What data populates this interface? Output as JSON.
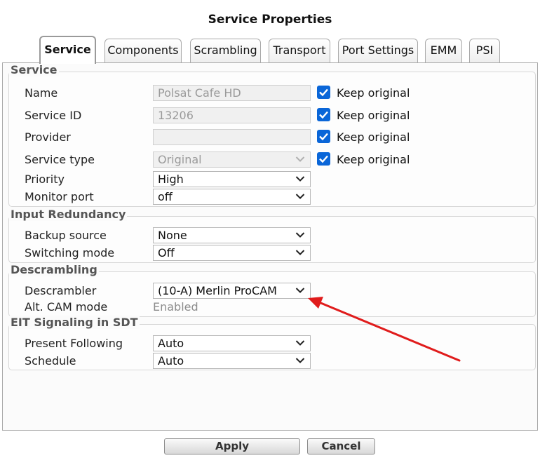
{
  "dialog": {
    "title": "Service Properties"
  },
  "tabs": [
    {
      "label": "Service",
      "active": true
    },
    {
      "label": "Components",
      "active": false
    },
    {
      "label": "Scrambling",
      "active": false
    },
    {
      "label": "Transport",
      "active": false
    },
    {
      "label": "Port Settings",
      "active": false
    },
    {
      "label": "EMM",
      "active": false
    },
    {
      "label": "PSI",
      "active": false
    }
  ],
  "service": {
    "legend": "Service",
    "name": {
      "label": "Name",
      "value": "Polsat Cafe HD",
      "keep_original": "Keep original"
    },
    "service_id": {
      "label": "Service ID",
      "value": "13206",
      "keep_original": "Keep original"
    },
    "provider": {
      "label": "Provider",
      "value": "",
      "keep_original": "Keep original"
    },
    "service_type": {
      "label": "Service type",
      "value": "Original",
      "keep_original": "Keep original"
    },
    "priority": {
      "label": "Priority",
      "value": "High"
    },
    "monitor_port": {
      "label": "Monitor port",
      "value": "off"
    }
  },
  "input_redundancy": {
    "legend": "Input Redundancy",
    "backup_source": {
      "label": "Backup source",
      "value": "None"
    },
    "switching_mode": {
      "label": "Switching mode",
      "value": "Off"
    }
  },
  "descrambling": {
    "legend": "Descrambling",
    "descrambler": {
      "label": "Descrambler",
      "value": "(10-A) Merlin ProCAM"
    },
    "alt_cam_mode": {
      "label": "Alt. CAM mode",
      "value": "Enabled"
    }
  },
  "eit": {
    "legend": "EIT Signaling in SDT",
    "present_following": {
      "label": "Present Following",
      "value": "Auto"
    },
    "schedule": {
      "label": "Schedule",
      "value": "Auto"
    }
  },
  "buttons": {
    "apply": "Apply",
    "cancel": "Cancel"
  },
  "colors": {
    "checkbox": "#0a66d8",
    "annotation_arrow": "#e01c1c"
  },
  "checkboxes_checked": true
}
